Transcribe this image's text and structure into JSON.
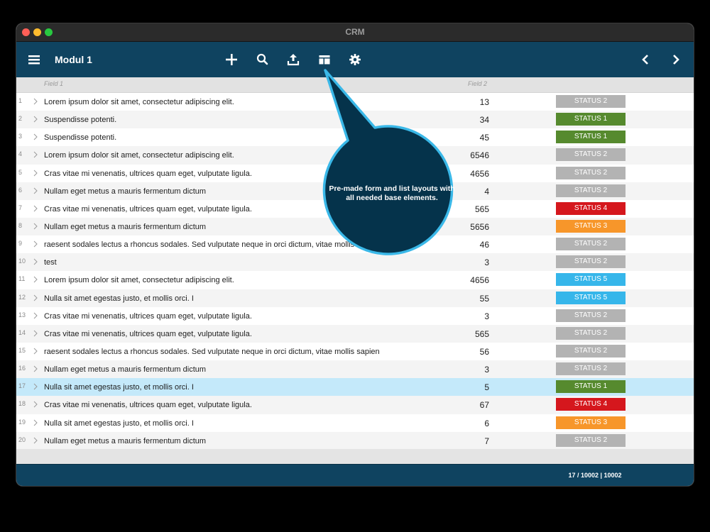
{
  "window": {
    "title": "CRM"
  },
  "toolbar": {
    "module_title": "Modul 1",
    "icons": [
      "menu-icon",
      "add-icon",
      "search-icon",
      "export-icon",
      "layout-icon",
      "settings-icon",
      "prev-icon",
      "next-icon"
    ]
  },
  "columns": {
    "field1": "Field 1",
    "field2": "Field 2"
  },
  "rows": [
    {
      "num": "1",
      "field1": "Lorem ipsum dolor sit amet, consectetur adipiscing elit.",
      "field2": "13",
      "status": "STATUS 2"
    },
    {
      "num": "2",
      "field1": "Suspendisse potenti.",
      "field2": "34",
      "status": "STATUS 1"
    },
    {
      "num": "3",
      "field1": "Suspendisse potenti.",
      "field2": "45",
      "status": "STATUS 1"
    },
    {
      "num": "4",
      "field1": "Lorem ipsum dolor sit amet, consectetur adipiscing elit.",
      "field2": "6546",
      "status": "STATUS 2"
    },
    {
      "num": "5",
      "field1": "Cras vitae mi venenatis, ultrices quam eget, vulputate ligula.",
      "field2": "4656",
      "status": "STATUS 2"
    },
    {
      "num": "6",
      "field1": "Nullam eget metus a mauris fermentum dictum",
      "field2": "4",
      "status": "STATUS 2"
    },
    {
      "num": "7",
      "field1": "Cras vitae mi venenatis, ultrices quam eget, vulputate ligula.",
      "field2": "565",
      "status": "STATUS 4"
    },
    {
      "num": "8",
      "field1": "Nullam eget metus a mauris fermentum dictum",
      "field2": "5656",
      "status": "STATUS 3"
    },
    {
      "num": "9",
      "field1": "raesent sodales lectus a rhoncus sodales. Sed vulputate neque in orci dictum, vitae mollis",
      "field2": "46",
      "status": "STATUS 2"
    },
    {
      "num": "10",
      "field1": "test",
      "field2": "3",
      "status": "STATUS 2"
    },
    {
      "num": "11",
      "field1": "Lorem ipsum dolor sit amet, consectetur adipiscing elit.",
      "field2": "4656",
      "status": "STATUS 5"
    },
    {
      "num": "12",
      "field1": "Nulla sit amet egestas justo, et mollis orci. I",
      "field2": "55",
      "status": "STATUS 5"
    },
    {
      "num": "13",
      "field1": "Cras vitae mi venenatis, ultrices quam eget, vulputate ligula.",
      "field2": "3",
      "status": "STATUS 2"
    },
    {
      "num": "14",
      "field1": "Cras vitae mi venenatis, ultrices quam eget, vulputate ligula.",
      "field2": "565",
      "status": "STATUS 2"
    },
    {
      "num": "15",
      "field1": "raesent sodales lectus a rhoncus sodales. Sed vulputate neque in orci dictum, vitae mollis sapien",
      "field2": "56",
      "status": "STATUS 2"
    },
    {
      "num": "16",
      "field1": "Nullam eget metus a mauris fermentum dictum",
      "field2": "3",
      "status": "STATUS 2"
    },
    {
      "num": "17",
      "field1": "Nulla sit amet egestas justo, et mollis orci. I",
      "field2": "5",
      "status": "STATUS 1",
      "selected": true
    },
    {
      "num": "18",
      "field1": "Cras vitae mi venenatis, ultrices quam eget, vulputate ligula.",
      "field2": "67",
      "status": "STATUS 4"
    },
    {
      "num": "19",
      "field1": "Nulla sit amet egestas justo, et mollis orci. I",
      "field2": "6",
      "status": "STATUS 3"
    },
    {
      "num": "20",
      "field1": "Nullam eget metus a mauris fermentum dictum",
      "field2": "7",
      "status": "STATUS 2"
    }
  ],
  "status_colors": {
    "STATUS 1": "#568a2e",
    "STATUS 2": "#b3b3b3",
    "STATUS 3": "#f7962a",
    "STATUS 4": "#d5171d",
    "STATUS 5": "#36b6ea"
  },
  "colors": {
    "toolbar": "#0f4360",
    "selected_row": "#c4e9fa",
    "callout_fill": "#05334b",
    "callout_border": "#3ab8e8"
  },
  "footer": {
    "record_info": "17 / 10002  |  10002"
  },
  "callout": {
    "text": "Pre-made form and list layouts with all needed base elements."
  }
}
